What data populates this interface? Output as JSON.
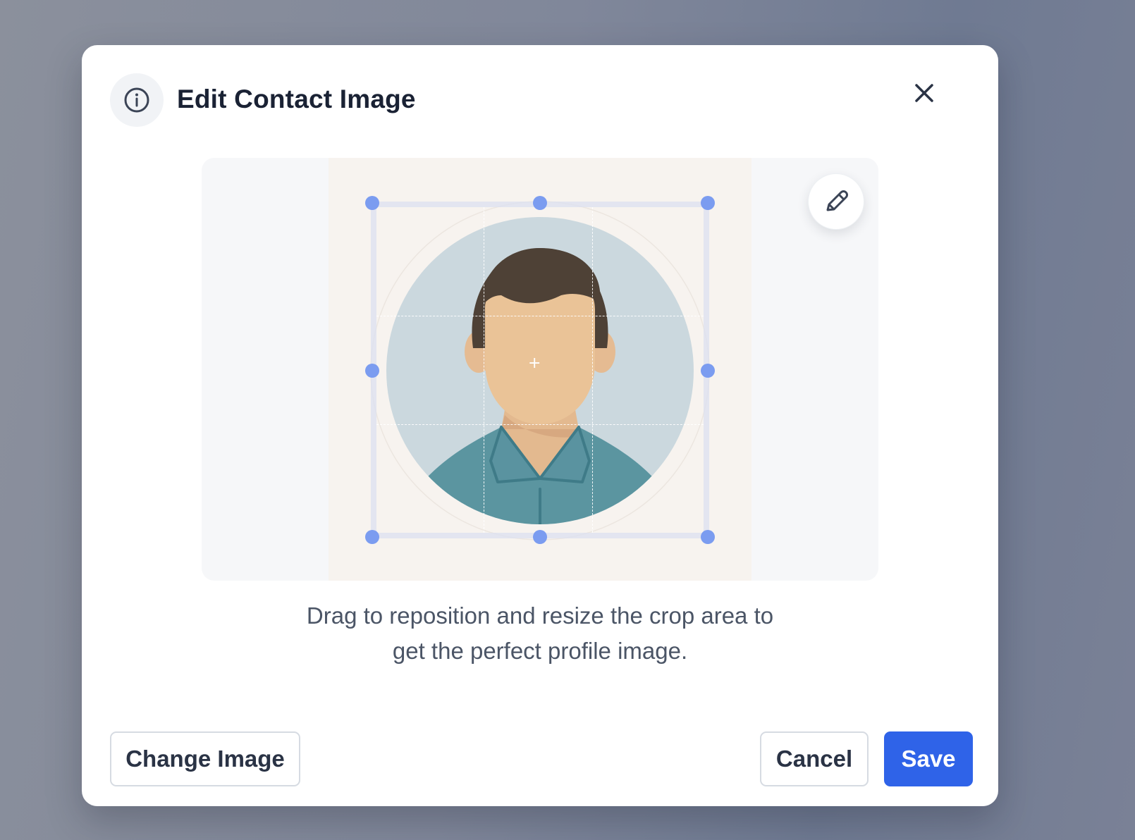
{
  "dialog": {
    "title": "Edit Contact Image",
    "header_icon": "info-icon",
    "close_icon": "close-icon",
    "edit_icon": "pencil-icon"
  },
  "crop": {
    "hint": "Drag to reposition and resize the crop area to get the perfect profile image.",
    "center_marker": "+"
  },
  "footer": {
    "change_image_label": "Change Image",
    "cancel_label": "Cancel",
    "save_label": "Save"
  },
  "colors": {
    "accent": "#2f63e8",
    "handle": "#7b9cf0",
    "title": "#1a2234"
  }
}
